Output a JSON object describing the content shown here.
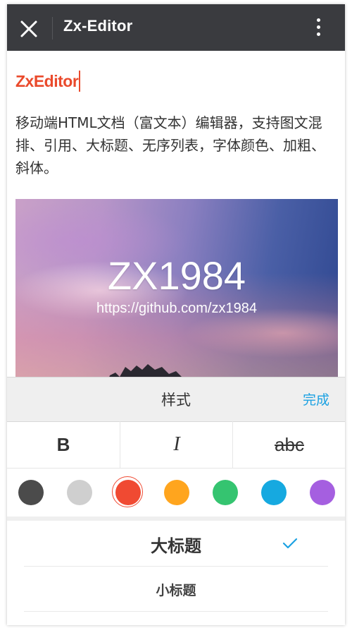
{
  "app_bar": {
    "title": "Zx-Editor",
    "close_icon": "close-icon",
    "more_icon": "more-vertical-icon",
    "background": "#3a3b3f"
  },
  "editor": {
    "doc_title": "ZxEditor",
    "doc_title_color": "#ea4a2c",
    "paragraph": "移动端HTML文档（富文本）编辑器，支持图文混排、引用、大标题、无序列表，字体颜色、加粗、斜体。",
    "image": {
      "title": "ZX1984",
      "url_text": "https://github.com/zx1984"
    }
  },
  "style_panel": {
    "title": "样式",
    "done_label": "完成",
    "accent": "#1ba1e2",
    "format_buttons": [
      {
        "label": "B",
        "name": "bold"
      },
      {
        "label": "I",
        "name": "italic"
      },
      {
        "label": "abc",
        "name": "strikethrough"
      }
    ],
    "colors": [
      "#4b4b4b",
      "#cfcfcf",
      "#f04a32",
      "#ffa51e",
      "#35c470",
      "#16a9e0",
      "#a55fe0"
    ],
    "selected_color": "#f04a32",
    "headings": [
      {
        "label": "大标题",
        "selected": true
      },
      {
        "label": "小标题",
        "selected": false
      }
    ]
  }
}
